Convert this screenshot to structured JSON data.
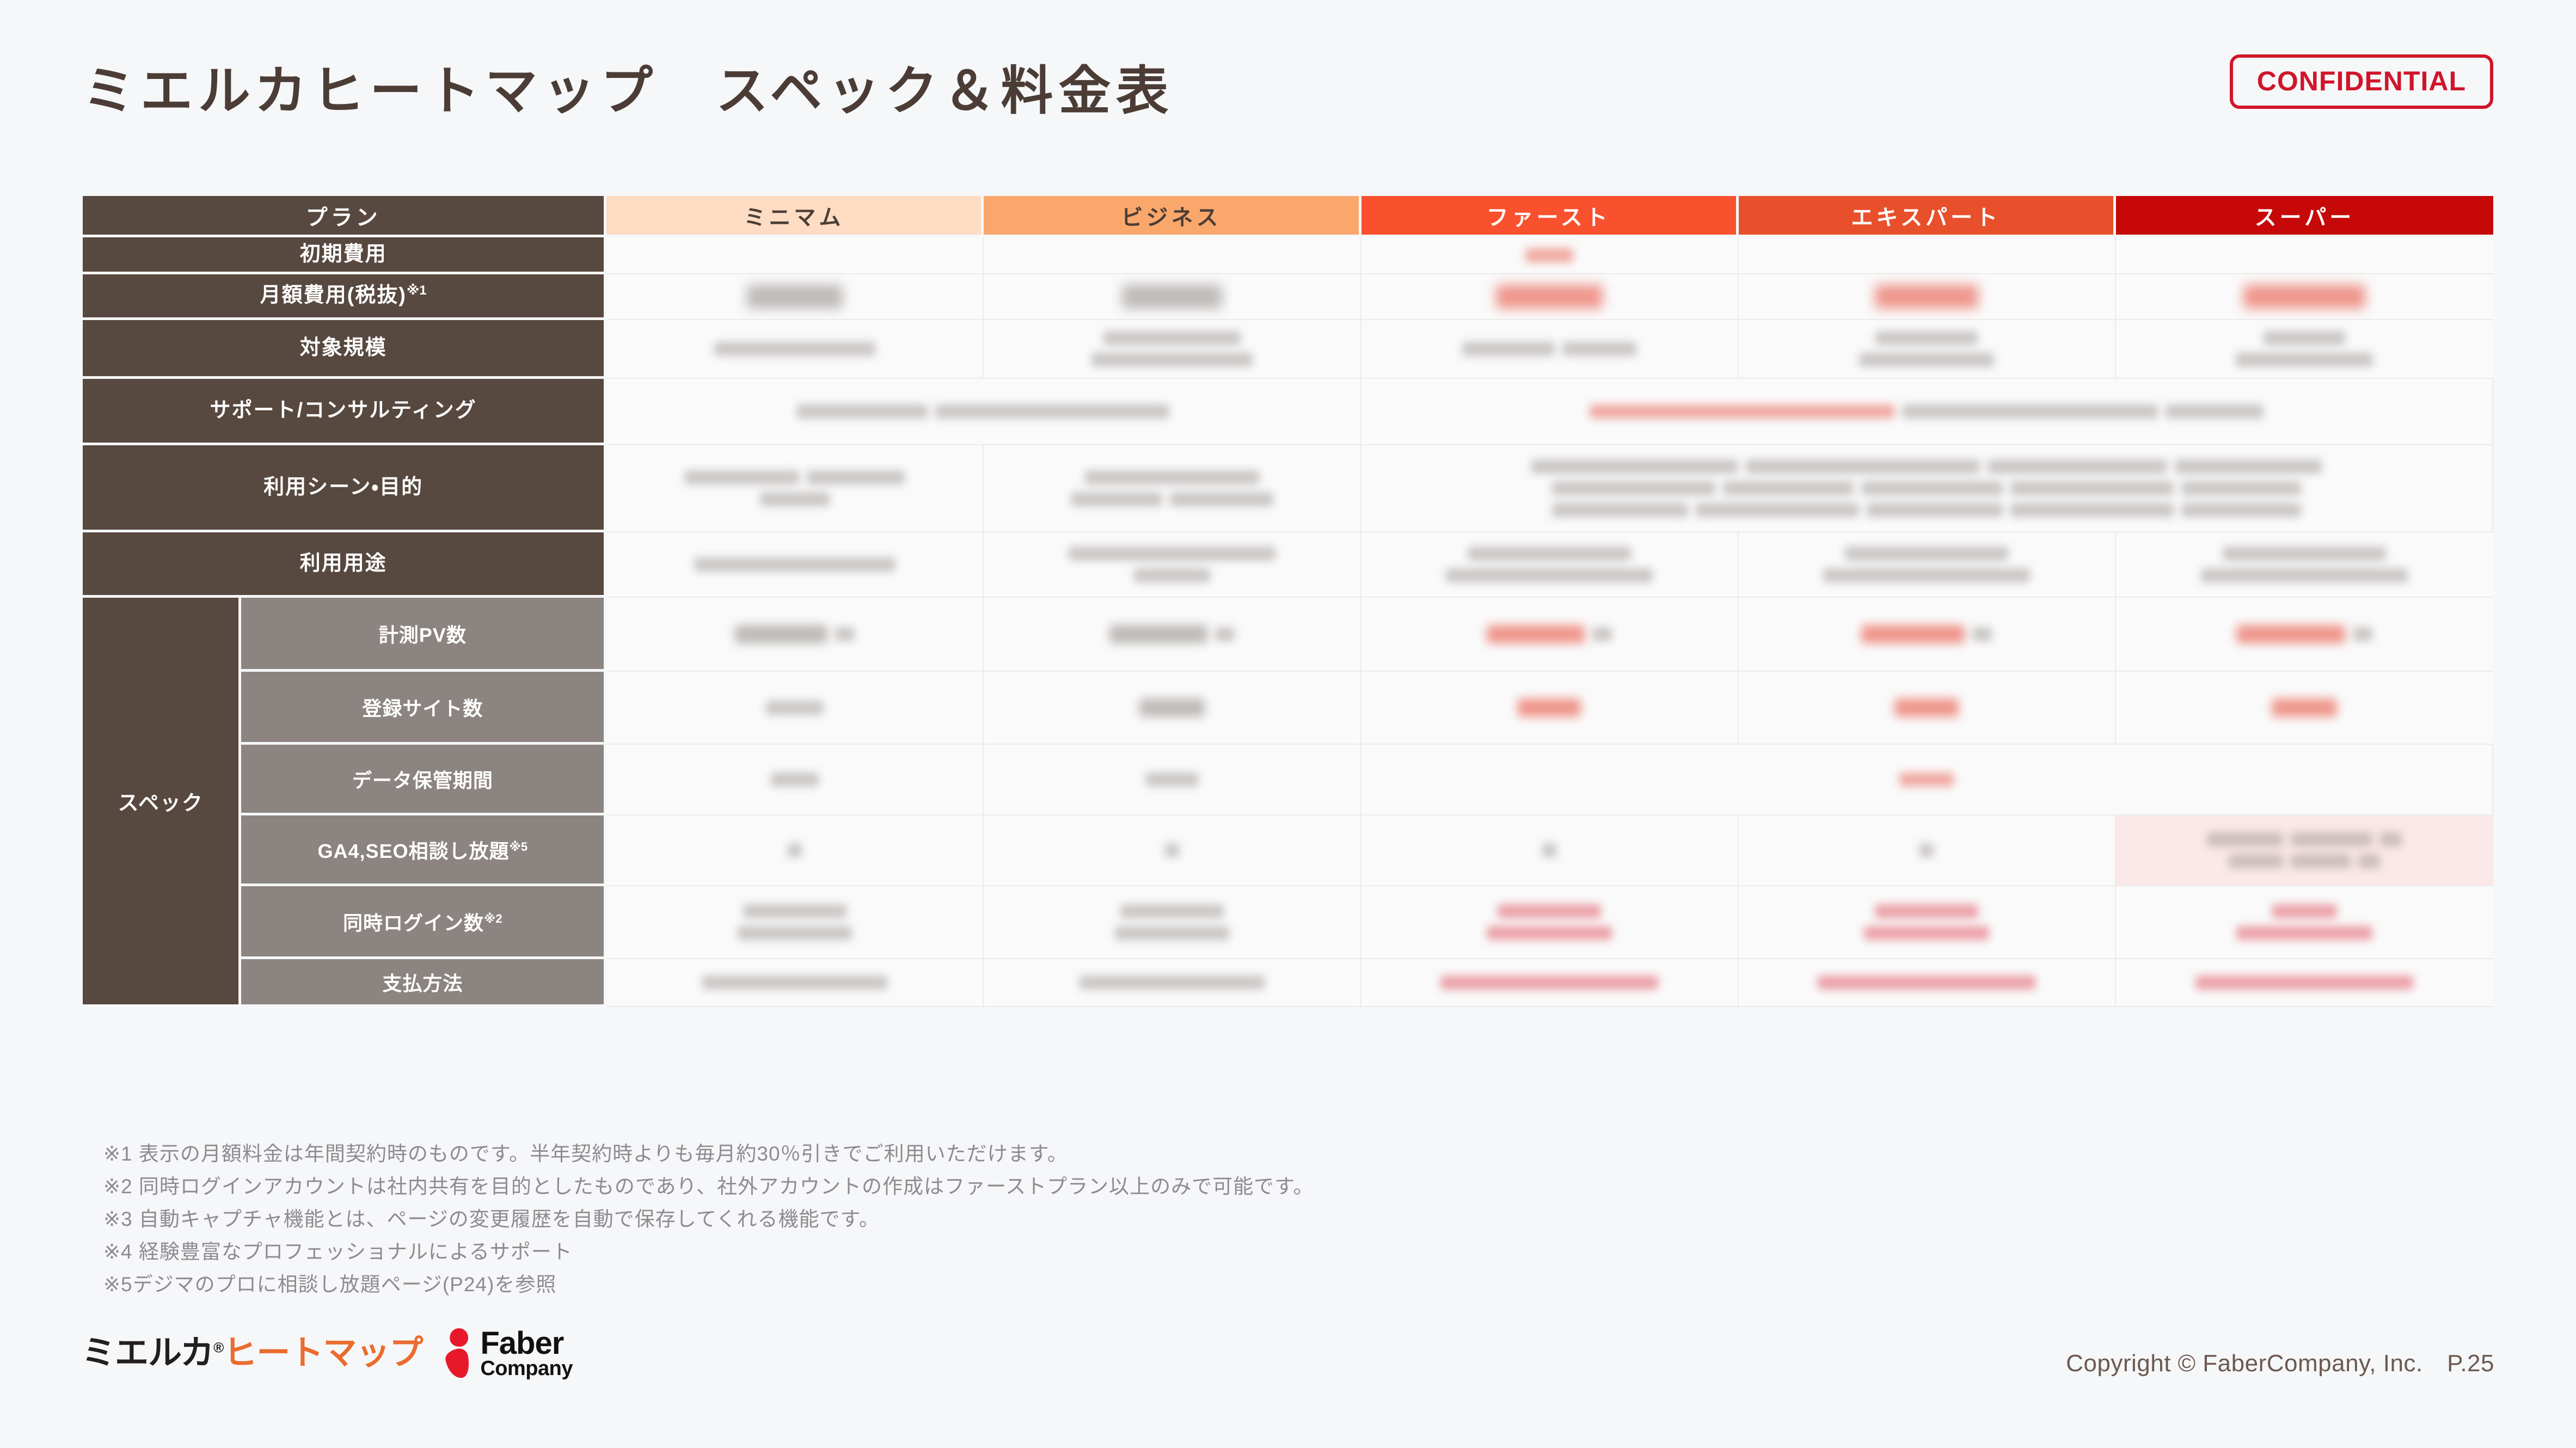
{
  "header": {
    "title": "ミエルカヒートマップ　スペック＆料金表",
    "confidential_label": "CONFIDENTIAL",
    "confidential_color": "#d0152a"
  },
  "table": {
    "plan_header_label": "プラン",
    "plans": [
      {
        "name": "ミニマム",
        "bg": "#fddcc3",
        "fg": "#4b3d36"
      },
      {
        "name": "ビジネス",
        "bg": "#faa76c",
        "fg": "#4b3d36"
      },
      {
        "name": "ファースト",
        "bg": "#f9512e",
        "fg": "#ffffff"
      },
      {
        "name": "エキスパート",
        "bg": "#e8502b",
        "fg": "#ffffff"
      },
      {
        "name": "スーパー",
        "bg": "#c60808",
        "fg": "#ffffff"
      }
    ],
    "rows": [
      {
        "label": "初期費用",
        "note": ""
      },
      {
        "label": "月額費用(税抜)",
        "note": "※1"
      },
      {
        "label": "対象規模",
        "note": ""
      },
      {
        "label": "サポート/コンサルティング",
        "note": ""
      },
      {
        "label": "利用シーン・目的",
        "note": ""
      },
      {
        "label": "利用用途",
        "note": ""
      }
    ],
    "spec_group_label": "スペック",
    "spec_rows": [
      {
        "label": "計測PV数",
        "note": ""
      },
      {
        "label": "登録サイト数",
        "note": ""
      },
      {
        "label": "データ保管期間",
        "note": ""
      },
      {
        "label": "GA4,SEO相談し放題",
        "note": "※5"
      },
      {
        "label": "同時ログイン数",
        "note": "※2"
      },
      {
        "label": "支払方法",
        "note": ""
      }
    ],
    "cell_state": "redacted",
    "label_bg": "#574840",
    "spec_sublabel_bg": "#8c8481",
    "cell_bg": "#fafafa",
    "highlight_bg": "#fbe8e8"
  },
  "footnotes": [
    "※1 表示の月額料金は年間契約時のものです。半年契約時よりも毎月約30％引きでご利用いただけます。",
    "※2 同時ログインアカウントは社内共有を目的としたものであり、社外アカウントの作成はファーストプラン以上のみで可能です。",
    "※3 自動キャプチャ機能とは、ページの変更履歴を自動で保存してくれる機能です。",
    "※4 経験豊富なプロフェッショナルによるサポート",
    "※5デジマのプロに相談し放題ページ(P24)を参照"
  ],
  "footer": {
    "logo_mieruka_dark": "ミエルカ",
    "logo_mieruka_reg": "®",
    "logo_mieruka_orange": "ヒートマップ",
    "logo_faber_line1": "Faber",
    "logo_faber_line2": "Company",
    "copyright": "Copyright © FaberCompany, Inc.　P.25"
  }
}
